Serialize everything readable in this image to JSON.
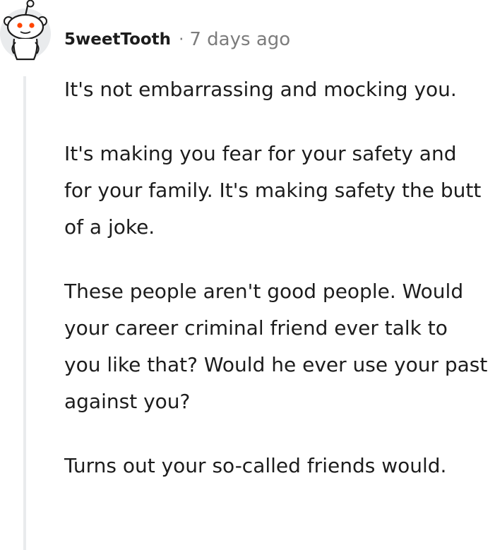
{
  "comment": {
    "author": "5weetTooth",
    "separator": "·",
    "timestamp": "7 days ago",
    "avatar_icon": "reddit-snoo-avatar-icon",
    "paragraphs": [
      "It's not embarrassing and mocking you.",
      "It's making you fear for your safety and for your family. It's making safety the butt of a joke.",
      "These people aren't good people. Would your career criminal friend ever talk to you like that? Would he ever use your past against you?",
      "Turns out your so-called friends would."
    ]
  },
  "colors": {
    "text": "#1c1c1c",
    "meta": "#7c7c7c",
    "thread_line": "#e9ebed",
    "avatar_bg": "#e9ebed",
    "snoo_eyes": "#ff4500"
  }
}
